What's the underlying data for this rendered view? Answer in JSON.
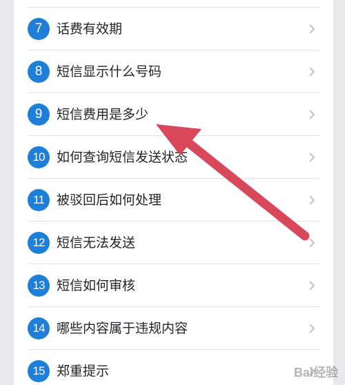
{
  "items": [
    {
      "number": "7",
      "label": "话费有效期"
    },
    {
      "number": "8",
      "label": "短信显示什么号码"
    },
    {
      "number": "9",
      "label": "短信费用是多少"
    },
    {
      "number": "10",
      "label": "如何查询短信发送状态"
    },
    {
      "number": "11",
      "label": "被驳回后如何处理"
    },
    {
      "number": "12",
      "label": "短信无法发送"
    },
    {
      "number": "13",
      "label": "短信如何审核"
    },
    {
      "number": "14",
      "label": "哪些内容属于违规内容"
    },
    {
      "number": "15",
      "label": "郑重提示"
    }
  ],
  "watermark": "Bai经验",
  "colors": {
    "badge": "#1d7fd8",
    "arrow": "#d9475a",
    "text": "#222427",
    "divider": "#e3e3e6"
  },
  "icons": {
    "row_chevron": "chevron-right-icon",
    "annotation": "red-arrow-icon"
  }
}
